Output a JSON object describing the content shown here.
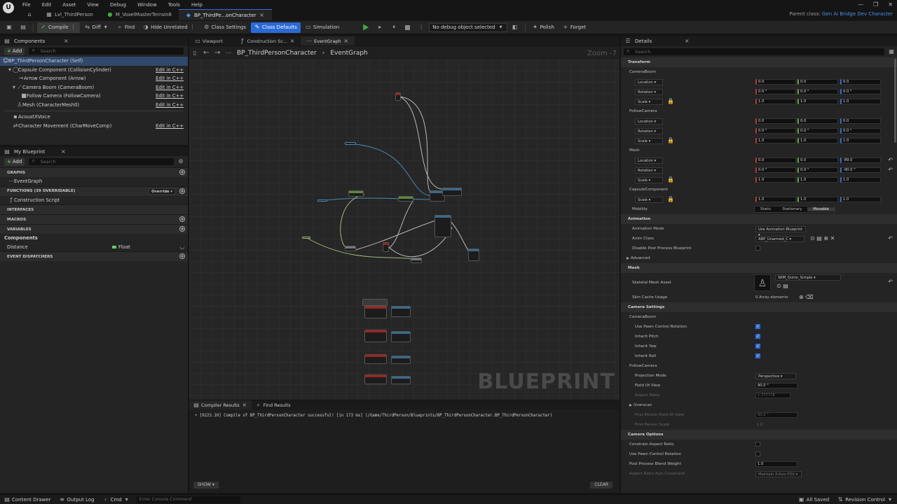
{
  "menu": [
    "File",
    "Edit",
    "Asset",
    "View",
    "Debug",
    "Window",
    "Tools",
    "Help"
  ],
  "tabs": [
    {
      "label": "Lvl_ThirdPerson"
    },
    {
      "label": "M_VoxelMasterTerrain8"
    },
    {
      "label": "BP_ThirdPe...onCharacter"
    }
  ],
  "parent_class": {
    "prefix": "Parent class:",
    "value": "Gen Ai Bridge Dev Character"
  },
  "toolbar": {
    "compile": "Compile",
    "diff": "Diff",
    "find": "Find",
    "hide_unrelated": "Hide Unrelated",
    "class_settings": "Class Settings",
    "class_defaults": "Class Defaults",
    "simulation": "Simulation",
    "debug_select": "No debug object selected",
    "polish": "Polish",
    "forget": "Forget"
  },
  "components_panel": {
    "title": "Components",
    "add": "Add",
    "search_placeholder": "Search",
    "items": [
      {
        "label": "BP_ThirdPersonCharacter (Self)",
        "edit": ""
      },
      {
        "label": "Capsule Component (CollisionCylinder)",
        "edit": "Edit in C++"
      },
      {
        "label": "Arrow Component (Arrow)",
        "edit": "Edit in C++"
      },
      {
        "label": "Camera Boom (CameraBoom)",
        "edit": "Edit in C++"
      },
      {
        "label": "Follow Camera (FollowCamera)",
        "edit": "Edit in C++"
      },
      {
        "label": "Mesh (CharacterMesh0)",
        "edit": "Edit in C++"
      },
      {
        "label": "AcoustXVoice",
        "edit": ""
      },
      {
        "label": "Character Movement (CharMoveComp)",
        "edit": "Edit in C++"
      }
    ]
  },
  "my_blueprint": {
    "title": "My Blueprint",
    "add": "Add",
    "search_placeholder": "Search",
    "graphs": "GRAPHS",
    "event_graph": "EventGraph",
    "functions": "FUNCTIONS (39 OVERRIDABLE)",
    "override": "Override",
    "construction_script": "Construction Script",
    "interfaces": "INTERFACES",
    "macros": "MACROS",
    "variables": "VARIABLES",
    "components": "Components",
    "var_name": "Distance",
    "var_type": "Float",
    "event_dispatchers": "EVENT DISPATCHERS"
  },
  "editor_tabs": [
    "Viewport",
    "Construction Sc...",
    "EventGraph"
  ],
  "breadcrumb": {
    "root": "BP_ThirdPersonCharacter",
    "leaf": "EventGraph"
  },
  "zoom": "Zoom -7",
  "watermark": "BLUEPRINT",
  "compiler": {
    "tab1": "Compiler Results",
    "tab2": "Find Results",
    "message": "[0223.10] Compile of BP_ThirdPersonCharacter successful! [in 173 ms] (/Game/ThirdPerson/Blueprints/BP_ThirdPersonCharacter.BP_ThirdPersonCharacter)",
    "show": "SHOW",
    "clear": "CLEAR"
  },
  "details": {
    "title": "Details",
    "search_placeholder": "Search",
    "transform": "Transform",
    "groups": [
      {
        "name": "CameraBoom",
        "rows": [
          {
            "label": "Location",
            "x": "0.0",
            "y": "0.0",
            "z": "0.0"
          },
          {
            "label": "Rotation",
            "x": "0.0 °",
            "y": "0.0 °",
            "z": "0.0 °"
          },
          {
            "label": "Scale",
            "x": "1.0",
            "y": "1.0",
            "z": "1.0"
          }
        ]
      },
      {
        "name": "FollowCamera",
        "rows": [
          {
            "label": "Location",
            "x": "0.0",
            "y": "0.0",
            "z": "0.0"
          },
          {
            "label": "Rotation",
            "x": "0.0 °",
            "y": "0.0 °",
            "z": "0.0 °"
          },
          {
            "label": "Scale",
            "x": "1.0",
            "y": "1.0",
            "z": "1.0"
          }
        ]
      },
      {
        "name": "Mesh",
        "rows": [
          {
            "label": "Location",
            "x": "0.0",
            "y": "0.0",
            "z": "-89.0"
          },
          {
            "label": "Rotation",
            "x": "0.0 °",
            "y": "0.0 °",
            "z": "-90.0 °"
          },
          {
            "label": "Scale",
            "x": "1.0",
            "y": "1.0",
            "z": "1.0"
          }
        ]
      },
      {
        "name": "CapsuleComponent",
        "rows": [
          {
            "label": "Scale",
            "x": "1.0",
            "y": "1.0",
            "z": "1.0"
          }
        ]
      }
    ],
    "mobility": "Mobility",
    "mob_opts": [
      "Static",
      "Stationary",
      "Movable"
    ],
    "animation": "Animation",
    "anim_mode_label": "Animation Mode",
    "anim_mode": "Use Animation Blueprint",
    "anim_class_label": "Anim Class",
    "anim_class": "ABP_Unarmed_C",
    "disable_post": "Disable Post Process Blueprint",
    "advanced": "Advanced",
    "mesh": "Mesh",
    "skeletal_label": "Skeletal Mesh Asset",
    "skeletal": "SKM_Quinn_Simple",
    "skin_cache": "Skin Cache Usage",
    "array_elems": "0 Array elements",
    "camera_settings": "Camera Settings",
    "cameraboom": "CameraBoom",
    "use_pawn": "Use Pawn Control Rotation",
    "inherit_pitch": "Inherit Pitch",
    "inherit_yaw": "Inherit Yaw",
    "inherit_roll": "Inherit Roll",
    "followcamera": "FollowCamera",
    "proj_label": "Projection Mode",
    "proj": "Perspective",
    "fov_label": "Field Of View",
    "fov": "90.0 °",
    "aspect_label": "Aspect Ratio",
    "aspect": "1.777778",
    "overscan": "Overscan",
    "fp_fov_label": "First Person Field Of View",
    "fp_fov": "90.0 °",
    "fp_scale_label": "First Person Scale",
    "fp_scale": "1.0",
    "camera_options": "Camera Options",
    "constrain": "Constrain Aspect Ratio",
    "use_pawn2": "Use Pawn Control Rotation",
    "post_blend_label": "Post Process Blend Weight",
    "post_blend": "1.0",
    "axis_label": "Aspect Ratio Axis Constraint",
    "axis": "Maintain X-Axis FOV"
  },
  "status": {
    "content_drawer": "Content Drawer",
    "output_log": "Output Log",
    "cmd": "Cmd",
    "console_placeholder": "Enter Console Command",
    "saved": "All Saved",
    "revision": "Revision Control"
  }
}
